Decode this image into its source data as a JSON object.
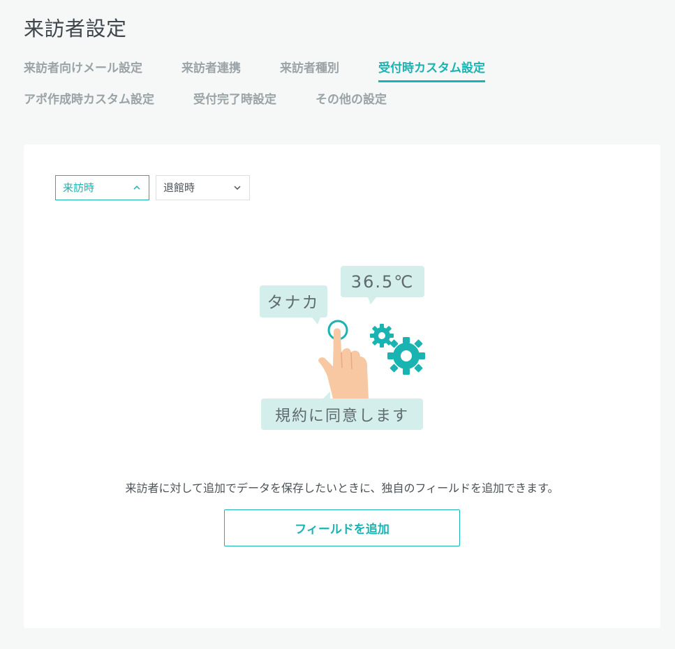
{
  "page": {
    "title": "来訪者設定"
  },
  "tabs": {
    "row1": [
      {
        "label": "来訪者向けメール設定",
        "active": false
      },
      {
        "label": "来訪者連携",
        "active": false
      },
      {
        "label": "来訪者種別",
        "active": false
      },
      {
        "label": "受付時カスタム設定",
        "active": true
      }
    ],
    "row2": [
      {
        "label": "アポ作成時カスタム設定",
        "active": false
      },
      {
        "label": "受付完了時設定",
        "active": false
      },
      {
        "label": "その他の設定",
        "active": false
      }
    ]
  },
  "filters": {
    "visit": {
      "label": "来訪時",
      "state": "expanded"
    },
    "leave": {
      "label": "退館時",
      "state": "collapsed"
    }
  },
  "illustration": {
    "bubble_name": "タナカ",
    "bubble_temp": "36.5℃",
    "bubble_agree": "規約に同意します"
  },
  "colors": {
    "accent": "#19b3b2",
    "bubble": "#d4eeec",
    "background": "#f6f7f7",
    "hand": "#f8c8a3"
  },
  "main": {
    "description": "来訪者に対して追加でデータを保存したいときに、独自のフィールドを追加できます。",
    "add_button_label": "フィールドを追加"
  }
}
